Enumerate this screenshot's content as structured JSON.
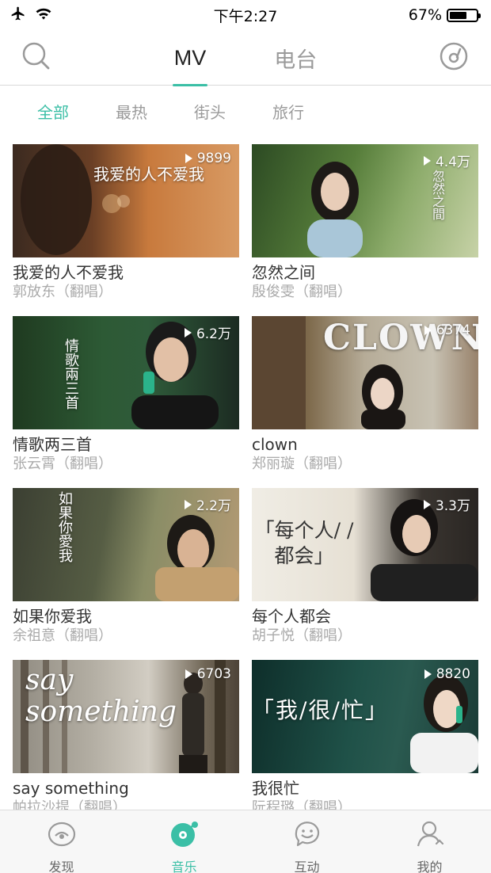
{
  "status_bar": {
    "time": "下午2:27",
    "battery": "67%",
    "battery_level": 0.67,
    "icons": [
      "airplane-icon",
      "wifi-icon",
      "battery-icon"
    ]
  },
  "top_nav": {
    "tabs": [
      {
        "label": "MV",
        "active": true
      },
      {
        "label": "电台",
        "active": false
      }
    ],
    "left_icon": "search-icon",
    "right_icon": "disc-icon"
  },
  "filters": [
    {
      "label": "全部",
      "active": true
    },
    {
      "label": "最热",
      "active": false
    },
    {
      "label": "街头",
      "active": false
    },
    {
      "label": "旅行",
      "active": false
    }
  ],
  "videos": [
    {
      "title": "我爱的人不爱我",
      "artist": "郭放东（翻唱）",
      "plays": "9899",
      "overlay": "我爱的人不爱我"
    },
    {
      "title": "忽然之间",
      "artist": "殷俊雯（翻唱）",
      "plays": "4.4万",
      "overlay": "忽然之間"
    },
    {
      "title": "情歌两三首",
      "artist": "张云霄（翻唱）",
      "plays": "6.2万",
      "overlay": "情歌兩三首"
    },
    {
      "title": "clown",
      "artist": "郑丽璇（翻唱）",
      "plays": "6374",
      "overlay": "CLOWN"
    },
    {
      "title": "如果你爱我",
      "artist": "余祖意（翻唱）",
      "plays": "2.2万",
      "overlay": "如果你愛我"
    },
    {
      "title": "每个人都会",
      "artist": "胡子悦（翻唱）",
      "plays": "3.3万",
      "overlay": "「每个人/ /都会」"
    },
    {
      "title": "say something",
      "artist": "帕拉沙提（翻唱）",
      "plays": "6703",
      "overlay": "say something"
    },
    {
      "title": "我很忙",
      "artist": "阮程璐（翻唱）",
      "plays": "8820",
      "overlay": "「我/很/忙」"
    }
  ],
  "bottom_tabs": [
    {
      "label": "发现",
      "icon": "eye-icon",
      "active": false
    },
    {
      "label": "音乐",
      "icon": "music-disc-icon",
      "active": true
    },
    {
      "label": "互动",
      "icon": "chat-smile-icon",
      "active": false
    },
    {
      "label": "我的",
      "icon": "profile-icon",
      "active": false
    }
  ],
  "colors": {
    "accent": "#3bbfa6",
    "inactive_text": "#9a9a9a",
    "title_text": "#333333",
    "subtitle_text": "#aaaaaa"
  }
}
